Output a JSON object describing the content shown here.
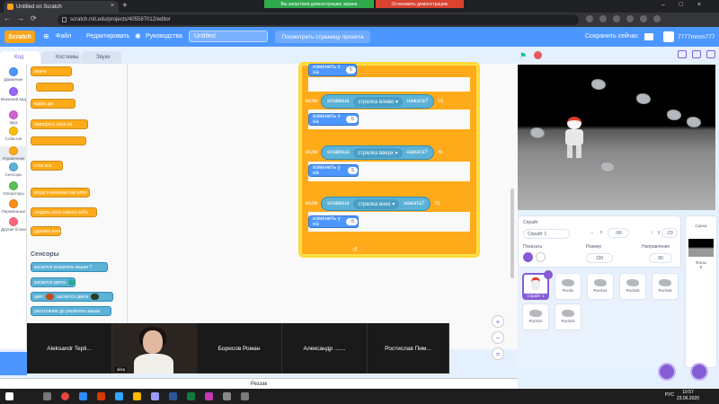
{
  "browser": {
    "tab_title": "Untitled on Scratch",
    "url": "scratch.mit.edu/projects/405587012/editor",
    "share_notice": "Вы запустили демонстрацию экрана",
    "stop_share": "Остановить демонстрацию"
  },
  "menu": {
    "logo": "Scratch",
    "file": "Файл",
    "edit": "Редактировать",
    "tutorials": "Руководства",
    "project_title": "Untitled",
    "see_project": "Посмотреть страницу проекта",
    "save_now": "Сохранить сейчас",
    "username": "7777mmm777"
  },
  "tabs": {
    "code": "Код",
    "costumes": "Костюмы",
    "sounds": "Звуки"
  },
  "categories": [
    {
      "label": "Движение",
      "color": "#4c97ff"
    },
    {
      "label": "Внешний вид",
      "color": "#9966ff"
    },
    {
      "label": "Звук",
      "color": "#cf63cf"
    },
    {
      "label": "События",
      "color": "#ffbf00"
    },
    {
      "label": "Управление",
      "color": "#ffab19"
    },
    {
      "label": "Сенсоры",
      "color": "#5cb1d6"
    },
    {
      "label": "Операторы",
      "color": "#59c059"
    },
    {
      "label": "Переменные",
      "color": "#ff8c1a"
    },
    {
      "label": "Другие блоки",
      "color": "#ff6680"
    }
  ],
  "palette": {
    "blocks_control": [
      "иначе",
      "ждать до",
      "повторять пока не",
      "стоп  все",
      "когда я начинаю как клон",
      "создать клон  самого себя",
      "удалить клон"
    ],
    "sensors_heading": "Сенсоры",
    "blocks_sensors": [
      "касается  указатель мыши  ?",
      "касается цвета",
      "цвет",
      "касается цвета",
      "расстояние до   указатель мыши"
    ]
  },
  "script": {
    "rows": [
      {
        "type": "motion",
        "label": "изменить х на",
        "value": "5"
      },
      {
        "type": "if",
        "if_word": "если",
        "key_label": "клавиша",
        "key": "стрелка влево",
        "pressed": "нажата?",
        "then": "то"
      },
      {
        "type": "motion",
        "label": "изменить х на",
        "value": "-5"
      },
      {
        "type": "if",
        "if_word": "если",
        "key_label": "клавиша",
        "key": "стрелка вверх",
        "pressed": "нажата?",
        "then": "то"
      },
      {
        "type": "motion",
        "label": "изменить y на",
        "value": "5"
      },
      {
        "type": "if",
        "if_word": "если",
        "key_label": "клавиша",
        "key": "стрелка вниз",
        "pressed": "нажата?",
        "then": "то"
      },
      {
        "type": "motion",
        "label": "изменить y на",
        "value": "-5"
      }
    ]
  },
  "zoom_controls": [
    "+",
    "−",
    "="
  ],
  "sprite_info": {
    "sprite_label": "Спрайт",
    "sprite_name": "Спрайт 1",
    "x_label": "x",
    "x": "-90",
    "y_label": "y",
    "y": "-23",
    "show_label": "Показать",
    "size_label": "Размер",
    "size": "100",
    "direction_label": "Направление",
    "direction": "90"
  },
  "sprites": [
    "Спрайт 1",
    "Rocks",
    "Rocks4",
    "Rocks5",
    "Rocks6",
    "Rocks2",
    "Rocks3"
  ],
  "stage_panel": {
    "label": "Сцена",
    "backdrops_label": "Фоны",
    "backdrops": "5"
  },
  "zoom_call": {
    "participants": [
      "Aleksandr  Tepli...",
      "alisa",
      "Борисов Роман",
      "Александр .......",
      "Ростислав  Пим..."
    ]
  },
  "bottom": {
    "reszak": "Реззак"
  },
  "taskbar": {
    "lang": "РУС",
    "time": "10:57",
    "date": "23.06.2020"
  }
}
